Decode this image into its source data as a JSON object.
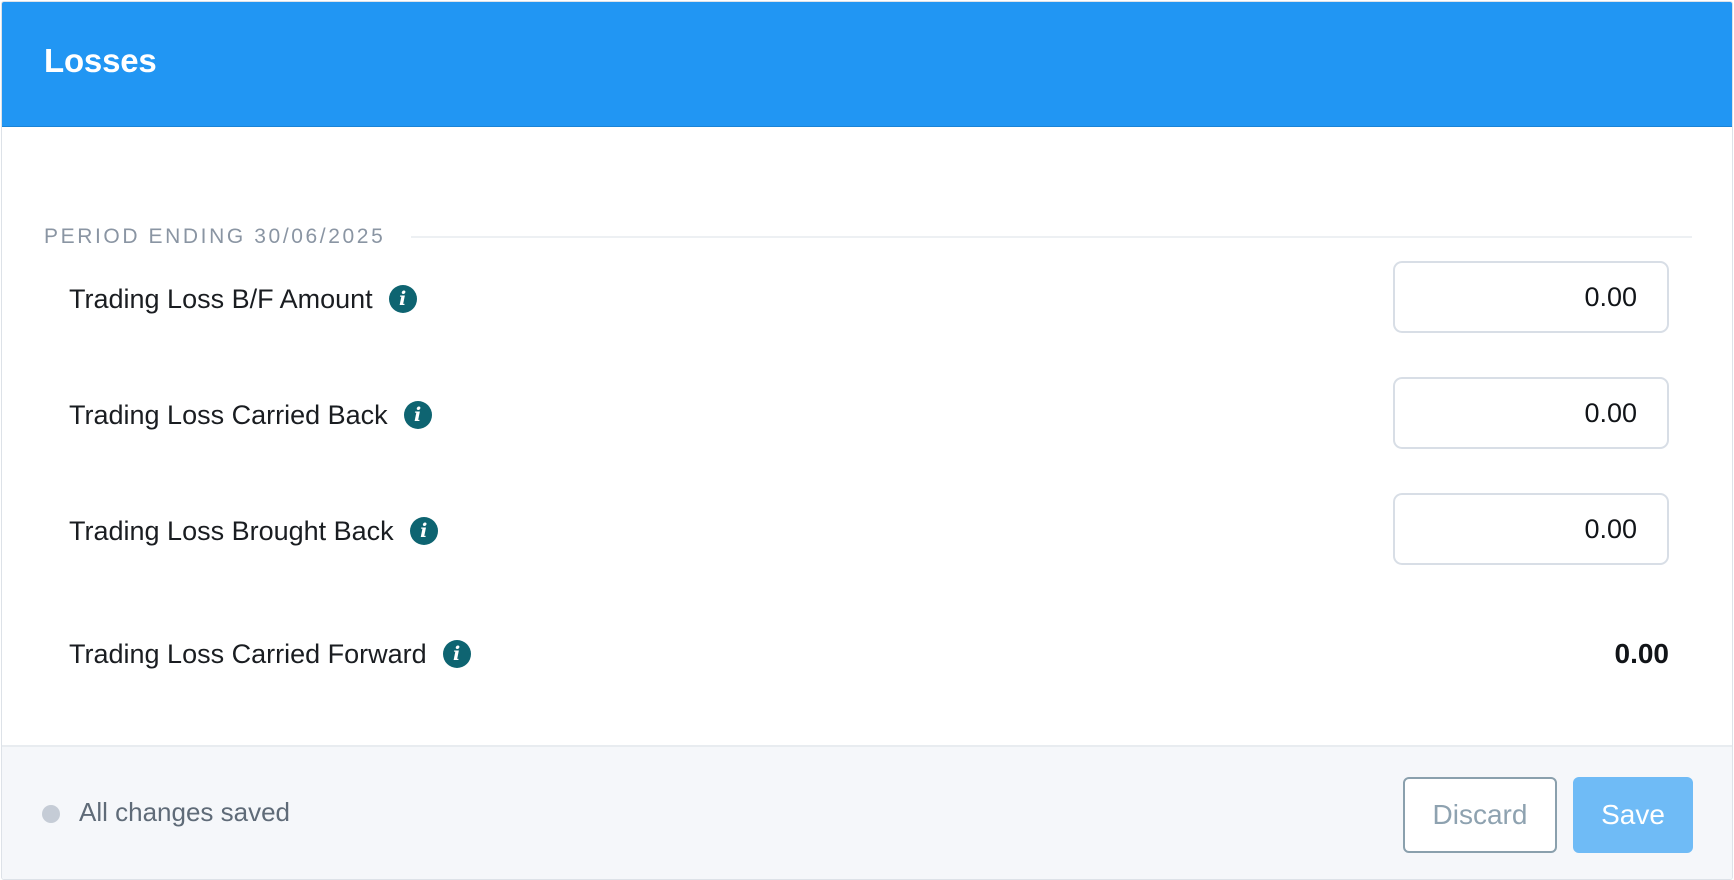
{
  "header": {
    "title": "Losses"
  },
  "section": {
    "label": "PERIOD ENDING 30/06/2025"
  },
  "rows": [
    {
      "label": "Trading Loss B/F Amount",
      "value": "0.00",
      "editable": true,
      "info_icon": "info-icon"
    },
    {
      "label": "Trading Loss Carried Back",
      "value": "0.00",
      "editable": true,
      "info_icon": "info-icon"
    },
    {
      "label": "Trading Loss Brought Back",
      "value": "0.00",
      "editable": true,
      "info_icon": "info-icon"
    },
    {
      "label": "Trading Loss Carried Forward",
      "value": "0.00",
      "editable": false,
      "info_icon": "info-icon"
    }
  ],
  "footer": {
    "status": "All changes saved",
    "discard_label": "Discard",
    "save_label": "Save"
  },
  "colors": {
    "header_bg": "#2196f3",
    "info_icon": "#0e6471",
    "save_button": "#6fbbf6",
    "discard_border": "#8aa0ad"
  }
}
